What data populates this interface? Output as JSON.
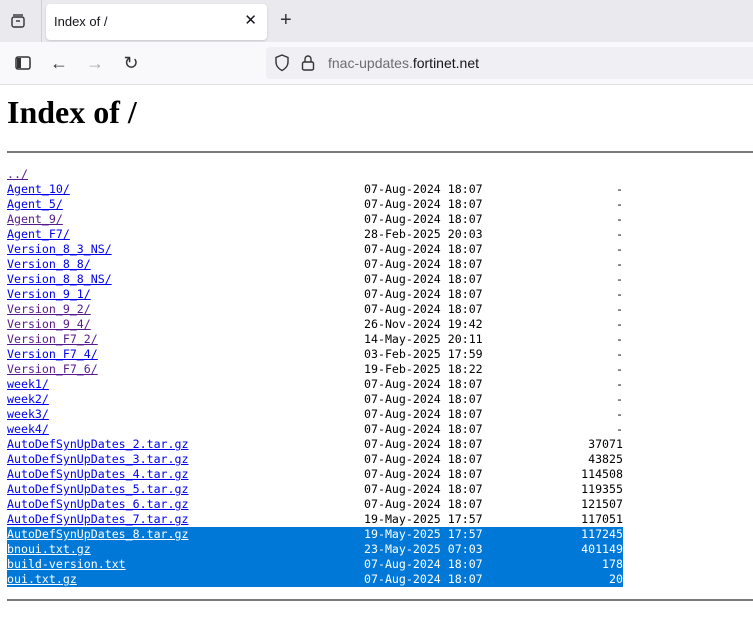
{
  "browser": {
    "tab_title": "Index of /",
    "url_subdomain": "fnac-updates.",
    "url_domain": "fortinet.net"
  },
  "page": {
    "title": "Index of /"
  },
  "entries": [
    {
      "name": "../",
      "date": "",
      "size": "",
      "visited": true,
      "selected": false
    },
    {
      "name": "Agent_10/",
      "date": "07-Aug-2024 18:07",
      "size": "-",
      "visited": false,
      "selected": false
    },
    {
      "name": "Agent_5/",
      "date": "07-Aug-2024 18:07",
      "size": "-",
      "visited": false,
      "selected": false
    },
    {
      "name": "Agent_9/",
      "date": "07-Aug-2024 18:07",
      "size": "-",
      "visited": true,
      "selected": false
    },
    {
      "name": "Agent_F7/",
      "date": "28-Feb-2025 20:03",
      "size": "-",
      "visited": false,
      "selected": false
    },
    {
      "name": "Version_8_3_NS/",
      "date": "07-Aug-2024 18:07",
      "size": "-",
      "visited": false,
      "selected": false
    },
    {
      "name": "Version_8_8/",
      "date": "07-Aug-2024 18:07",
      "size": "-",
      "visited": false,
      "selected": false
    },
    {
      "name": "Version_8_8_NS/",
      "date": "07-Aug-2024 18:07",
      "size": "-",
      "visited": false,
      "selected": false
    },
    {
      "name": "Version_9_1/",
      "date": "07-Aug-2024 18:07",
      "size": "-",
      "visited": false,
      "selected": false
    },
    {
      "name": "Version_9_2/",
      "date": "07-Aug-2024 18:07",
      "size": "-",
      "visited": true,
      "selected": false
    },
    {
      "name": "Version_9_4/",
      "date": "26-Nov-2024 19:42",
      "size": "-",
      "visited": true,
      "selected": false
    },
    {
      "name": "Version_F7_2/",
      "date": "14-May-2025 20:11",
      "size": "-",
      "visited": true,
      "selected": false
    },
    {
      "name": "Version_F7_4/",
      "date": "03-Feb-2025 17:59",
      "size": "-",
      "visited": false,
      "selected": false
    },
    {
      "name": "Version_F7_6/",
      "date": "19-Feb-2025 18:22",
      "size": "-",
      "visited": true,
      "selected": false
    },
    {
      "name": "week1/",
      "date": "07-Aug-2024 18:07",
      "size": "-",
      "visited": false,
      "selected": false
    },
    {
      "name": "week2/",
      "date": "07-Aug-2024 18:07",
      "size": "-",
      "visited": false,
      "selected": false
    },
    {
      "name": "week3/",
      "date": "07-Aug-2024 18:07",
      "size": "-",
      "visited": false,
      "selected": false
    },
    {
      "name": "week4/",
      "date": "07-Aug-2024 18:07",
      "size": "-",
      "visited": false,
      "selected": false
    },
    {
      "name": "AutoDefSynUpDates_2.tar.gz",
      "date": "07-Aug-2024 18:07",
      "size": "37071",
      "visited": false,
      "selected": false
    },
    {
      "name": "AutoDefSynUpDates_3.tar.gz",
      "date": "07-Aug-2024 18:07",
      "size": "43825",
      "visited": false,
      "selected": false
    },
    {
      "name": "AutoDefSynUpDates_4.tar.gz",
      "date": "07-Aug-2024 18:07",
      "size": "114508",
      "visited": false,
      "selected": false
    },
    {
      "name": "AutoDefSynUpDates_5.tar.gz",
      "date": "07-Aug-2024 18:07",
      "size": "119355",
      "visited": false,
      "selected": false
    },
    {
      "name": "AutoDefSynUpDates_6.tar.gz",
      "date": "07-Aug-2024 18:07",
      "size": "121507",
      "visited": false,
      "selected": false
    },
    {
      "name": "AutoDefSynUpDates_7.tar.gz",
      "date": "19-May-2025 17:57",
      "size": "117051",
      "visited": false,
      "selected": false
    },
    {
      "name": "AutoDefSynUpDates_8.tar.gz",
      "date": "19-May-2025 17:57",
      "size": "117245",
      "visited": false,
      "selected": true
    },
    {
      "name": "bnoui.txt.gz",
      "date": "23-May-2025 07:03",
      "size": "401149",
      "visited": false,
      "selected": true
    },
    {
      "name": "build-version.txt",
      "date": "07-Aug-2024 18:07",
      "size": "178",
      "visited": false,
      "selected": true
    },
    {
      "name": "oui.txt.gz",
      "date": "07-Aug-2024 18:07",
      "size": "20",
      "visited": false,
      "selected": true
    }
  ]
}
